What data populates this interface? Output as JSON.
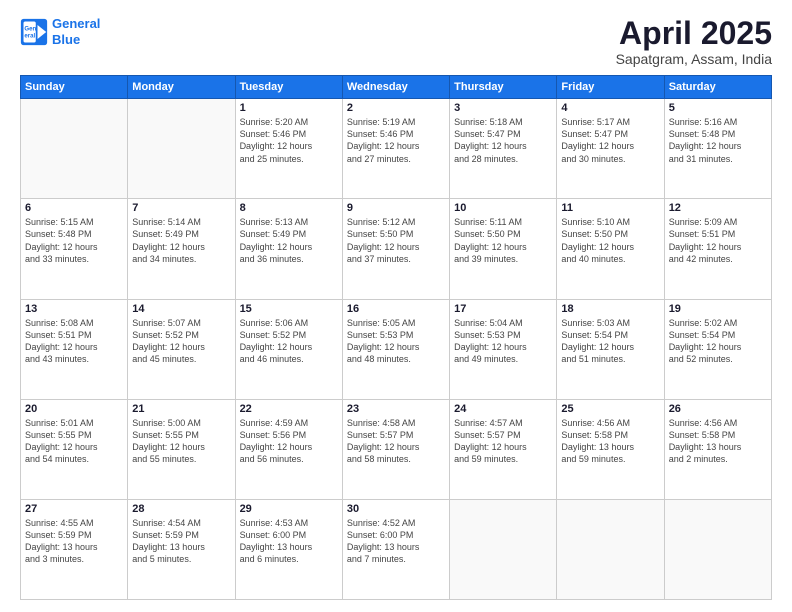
{
  "logo": {
    "line1": "General",
    "line2": "Blue"
  },
  "title": "April 2025",
  "subtitle": "Sapatgram, Assam, India",
  "weekdays": [
    "Sunday",
    "Monday",
    "Tuesday",
    "Wednesday",
    "Thursday",
    "Friday",
    "Saturday"
  ],
  "weeks": [
    [
      {
        "day": "",
        "info": ""
      },
      {
        "day": "",
        "info": ""
      },
      {
        "day": "1",
        "info": "Sunrise: 5:20 AM\nSunset: 5:46 PM\nDaylight: 12 hours\nand 25 minutes."
      },
      {
        "day": "2",
        "info": "Sunrise: 5:19 AM\nSunset: 5:46 PM\nDaylight: 12 hours\nand 27 minutes."
      },
      {
        "day": "3",
        "info": "Sunrise: 5:18 AM\nSunset: 5:47 PM\nDaylight: 12 hours\nand 28 minutes."
      },
      {
        "day": "4",
        "info": "Sunrise: 5:17 AM\nSunset: 5:47 PM\nDaylight: 12 hours\nand 30 minutes."
      },
      {
        "day": "5",
        "info": "Sunrise: 5:16 AM\nSunset: 5:48 PM\nDaylight: 12 hours\nand 31 minutes."
      }
    ],
    [
      {
        "day": "6",
        "info": "Sunrise: 5:15 AM\nSunset: 5:48 PM\nDaylight: 12 hours\nand 33 minutes."
      },
      {
        "day": "7",
        "info": "Sunrise: 5:14 AM\nSunset: 5:49 PM\nDaylight: 12 hours\nand 34 minutes."
      },
      {
        "day": "8",
        "info": "Sunrise: 5:13 AM\nSunset: 5:49 PM\nDaylight: 12 hours\nand 36 minutes."
      },
      {
        "day": "9",
        "info": "Sunrise: 5:12 AM\nSunset: 5:50 PM\nDaylight: 12 hours\nand 37 minutes."
      },
      {
        "day": "10",
        "info": "Sunrise: 5:11 AM\nSunset: 5:50 PM\nDaylight: 12 hours\nand 39 minutes."
      },
      {
        "day": "11",
        "info": "Sunrise: 5:10 AM\nSunset: 5:50 PM\nDaylight: 12 hours\nand 40 minutes."
      },
      {
        "day": "12",
        "info": "Sunrise: 5:09 AM\nSunset: 5:51 PM\nDaylight: 12 hours\nand 42 minutes."
      }
    ],
    [
      {
        "day": "13",
        "info": "Sunrise: 5:08 AM\nSunset: 5:51 PM\nDaylight: 12 hours\nand 43 minutes."
      },
      {
        "day": "14",
        "info": "Sunrise: 5:07 AM\nSunset: 5:52 PM\nDaylight: 12 hours\nand 45 minutes."
      },
      {
        "day": "15",
        "info": "Sunrise: 5:06 AM\nSunset: 5:52 PM\nDaylight: 12 hours\nand 46 minutes."
      },
      {
        "day": "16",
        "info": "Sunrise: 5:05 AM\nSunset: 5:53 PM\nDaylight: 12 hours\nand 48 minutes."
      },
      {
        "day": "17",
        "info": "Sunrise: 5:04 AM\nSunset: 5:53 PM\nDaylight: 12 hours\nand 49 minutes."
      },
      {
        "day": "18",
        "info": "Sunrise: 5:03 AM\nSunset: 5:54 PM\nDaylight: 12 hours\nand 51 minutes."
      },
      {
        "day": "19",
        "info": "Sunrise: 5:02 AM\nSunset: 5:54 PM\nDaylight: 12 hours\nand 52 minutes."
      }
    ],
    [
      {
        "day": "20",
        "info": "Sunrise: 5:01 AM\nSunset: 5:55 PM\nDaylight: 12 hours\nand 54 minutes."
      },
      {
        "day": "21",
        "info": "Sunrise: 5:00 AM\nSunset: 5:55 PM\nDaylight: 12 hours\nand 55 minutes."
      },
      {
        "day": "22",
        "info": "Sunrise: 4:59 AM\nSunset: 5:56 PM\nDaylight: 12 hours\nand 56 minutes."
      },
      {
        "day": "23",
        "info": "Sunrise: 4:58 AM\nSunset: 5:57 PM\nDaylight: 12 hours\nand 58 minutes."
      },
      {
        "day": "24",
        "info": "Sunrise: 4:57 AM\nSunset: 5:57 PM\nDaylight: 12 hours\nand 59 minutes."
      },
      {
        "day": "25",
        "info": "Sunrise: 4:56 AM\nSunset: 5:58 PM\nDaylight: 13 hours\nand 59 minutes."
      },
      {
        "day": "26",
        "info": "Sunrise: 4:56 AM\nSunset: 5:58 PM\nDaylight: 13 hours\nand 2 minutes."
      }
    ],
    [
      {
        "day": "27",
        "info": "Sunrise: 4:55 AM\nSunset: 5:59 PM\nDaylight: 13 hours\nand 3 minutes."
      },
      {
        "day": "28",
        "info": "Sunrise: 4:54 AM\nSunset: 5:59 PM\nDaylight: 13 hours\nand 5 minutes."
      },
      {
        "day": "29",
        "info": "Sunrise: 4:53 AM\nSunset: 6:00 PM\nDaylight: 13 hours\nand 6 minutes."
      },
      {
        "day": "30",
        "info": "Sunrise: 4:52 AM\nSunset: 6:00 PM\nDaylight: 13 hours\nand 7 minutes."
      },
      {
        "day": "",
        "info": ""
      },
      {
        "day": "",
        "info": ""
      },
      {
        "day": "",
        "info": ""
      }
    ]
  ]
}
